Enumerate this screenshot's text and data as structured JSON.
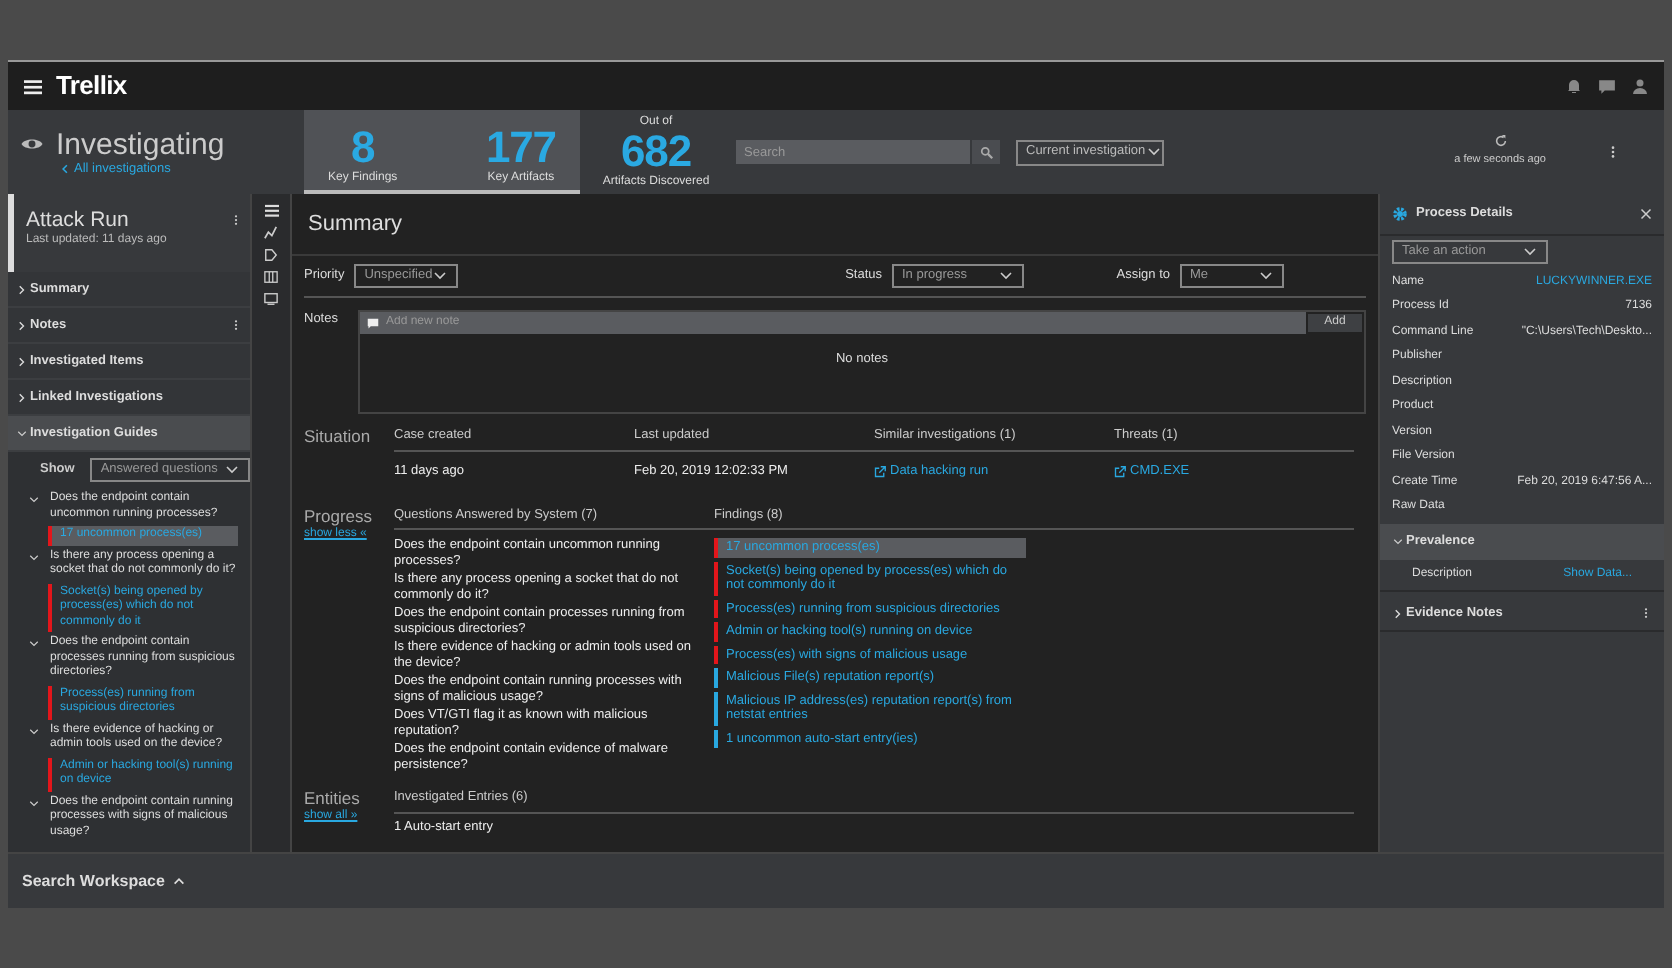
{
  "topbar": {
    "logo": "Trellix"
  },
  "header": {
    "title": "Investigating",
    "back_link": "All investigations",
    "stats": [
      {
        "value": "8",
        "label": "Key Findings"
      },
      {
        "value": "177",
        "label": "Key Artifacts"
      }
    ],
    "total": {
      "caption": "Out of",
      "value": "682",
      "label": "Artifacts Discovered"
    },
    "search": {
      "placeholder": "Search"
    },
    "scope": "Current investigation",
    "refreshed": "a few seconds ago"
  },
  "sidebar": {
    "title": "Attack Run",
    "subtitle": "Last updated: 11 days ago",
    "sections": [
      {
        "label": "Summary",
        "expanded": false,
        "menu": false
      },
      {
        "label": "Notes",
        "expanded": false,
        "menu": true
      },
      {
        "label": "Investigated Items",
        "expanded": false,
        "menu": false
      },
      {
        "label": "Linked Investigations",
        "expanded": false,
        "menu": false
      },
      {
        "label": "Investigation Guides",
        "expanded": true,
        "menu": false
      }
    ],
    "show_label": "Show",
    "show_value": "Answered questions",
    "questions": [
      {
        "text": "Does the endpoint contain uncommon running processes?",
        "findings": [
          {
            "text": "17 uncommon process(es)",
            "color": "#e3161b",
            "selected": true
          }
        ]
      },
      {
        "text": "Is there any process opening a socket that do not commonly do it?",
        "findings": [
          {
            "text": "Socket(s) being opened by process(es) which do not commonly do it",
            "color": "#e3161b",
            "selected": false
          }
        ]
      },
      {
        "text": "Does the endpoint contain processes running from suspicious directories?",
        "findings": [
          {
            "text": "Process(es) running from suspicious directories",
            "color": "#e3161b",
            "selected": false
          }
        ]
      },
      {
        "text": "Is there evidence of hacking or admin tools used on the device?",
        "findings": [
          {
            "text": "Admin or hacking tool(s) running on device",
            "color": "#e3161b",
            "selected": false
          }
        ]
      },
      {
        "text": "Does the endpoint contain running processes with signs of malicious usage?"
      }
    ]
  },
  "main": {
    "title": "Summary",
    "filters": [
      {
        "label": "Priority",
        "value": "Unspecified"
      },
      {
        "label": "Status",
        "value": "In progress"
      },
      {
        "label": "Assign to",
        "value": "Me"
      }
    ],
    "notes": {
      "label": "Notes",
      "placeholder": "Add new note",
      "button": "Add",
      "empty": "No notes"
    },
    "situation": {
      "title": "Situation",
      "columns": [
        {
          "header": "Case created",
          "value": "11 days ago",
          "kind": "text"
        },
        {
          "header": "Last updated",
          "value": "Feb 20, 2019 12:02:33 PM",
          "kind": "text"
        },
        {
          "header": "Similar investigations (1)",
          "value": "Data hacking run",
          "kind": "link"
        },
        {
          "header": "Threats (1)",
          "value": "CMD.EXE",
          "kind": "link"
        }
      ]
    },
    "progress": {
      "title": "Progress",
      "toggle": "show less «",
      "questions_header": "Questions Answered by System (7)",
      "findings_header": "Findings (8)",
      "questions": [
        "Does the endpoint contain uncommon running processes?",
        "Is there any process opening a socket that do not commonly do it?",
        "Does the endpoint contain processes running from suspicious directories?",
        "Is there evidence of hacking or admin tools used on the device?",
        "Does the endpoint contain running processes with signs of malicious usage?",
        "Does VT/GTI flag it as known with malicious reputation?",
        "Does the endpoint contain evidence of malware persistence?"
      ],
      "findings": [
        {
          "text": "17 uncommon process(es)",
          "color": "#e3161b",
          "selected": true
        },
        {
          "text": "Socket(s) being opened by process(es) which do not commonly do it",
          "color": "#e3161b",
          "selected": false
        },
        {
          "text": "Process(es) running from suspicious directories",
          "color": "#e3161b",
          "selected": false
        },
        {
          "text": "Admin or hacking tool(s) running on device",
          "color": "#e3161b",
          "selected": false
        },
        {
          "text": "Process(es) with signs of malicious usage",
          "color": "#e3161b",
          "selected": false
        },
        {
          "text": "Malicious File(s) reputation report(s)",
          "color": "#29a8e0",
          "selected": false
        },
        {
          "text": "Malicious IP address(es) reputation report(s) from netstat entries",
          "color": "#29a8e0",
          "selected": false
        },
        {
          "text": "1 uncommon auto-start entry(ies)",
          "color": "#29a8e0",
          "selected": false
        }
      ]
    },
    "entities": {
      "title": "Entities",
      "toggle": "show all »",
      "header": "Investigated Entries (6)",
      "rows": [
        "1 Auto-start entry"
      ]
    }
  },
  "details": {
    "title": "Process Details",
    "action": "Take an action",
    "properties": [
      {
        "name": "Name",
        "value": "LUCKYWINNER.EXE",
        "kind": "link"
      },
      {
        "name": "Process Id",
        "value": "7136",
        "kind": "text"
      },
      {
        "name": "Command Line",
        "value": "\"C:\\Users\\Tech\\Deskto...",
        "kind": "text"
      },
      {
        "name": "Publisher"
      },
      {
        "name": "Description"
      },
      {
        "name": "Product"
      },
      {
        "name": "Version"
      },
      {
        "name": "File Version"
      },
      {
        "name": "Create Time",
        "value": "Feb 20, 2019 6:47:56 A...",
        "kind": "text"
      },
      {
        "name": "Raw Data"
      }
    ],
    "sections": [
      {
        "label": "Prevalence",
        "expanded": true,
        "rows": [
          {
            "name": "Description",
            "value": "Show Data..."
          }
        ]
      },
      {
        "label": "Evidence Notes",
        "expanded": false
      }
    ]
  },
  "footer": {
    "label": "Search Workspace"
  }
}
